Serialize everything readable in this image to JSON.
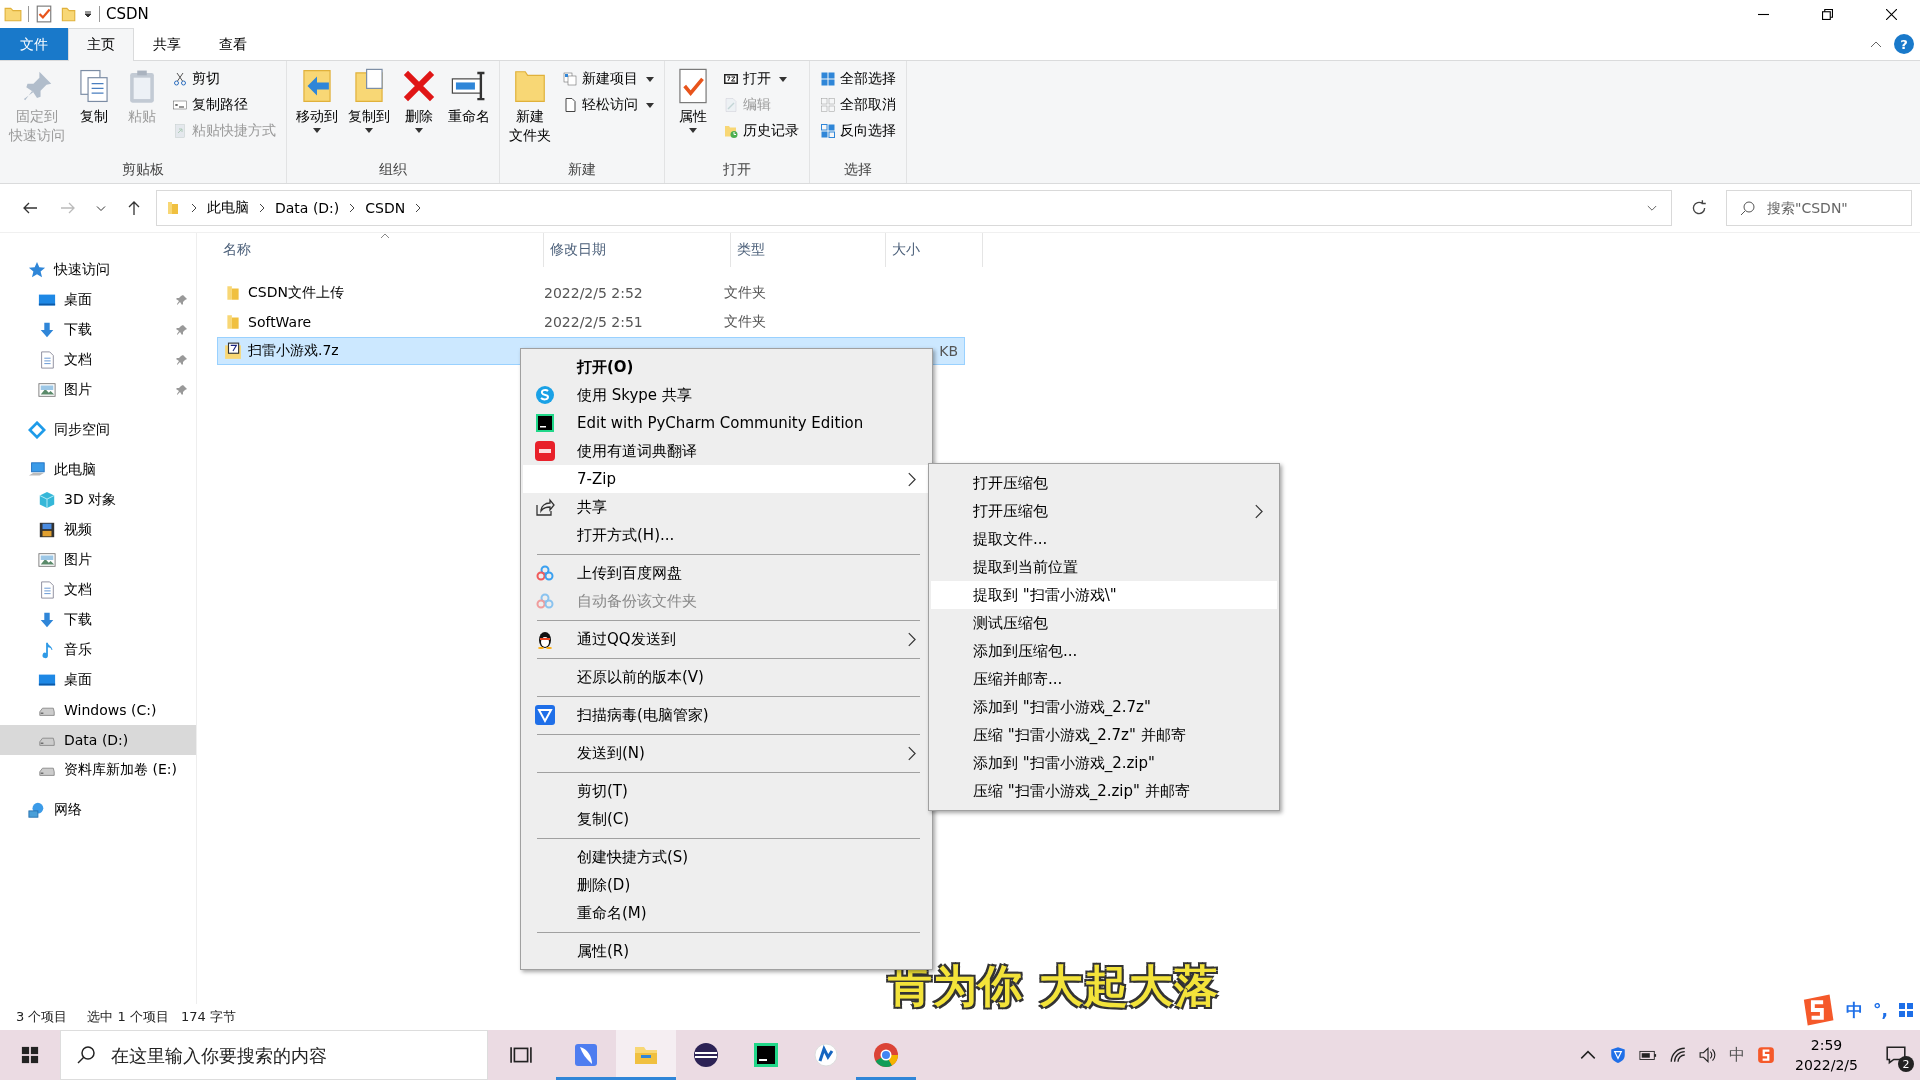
{
  "window": {
    "title": "CSDN"
  },
  "ribbon_tabs": [
    {
      "label": "文件",
      "kind": "file",
      "selected": false
    },
    {
      "label": "主页",
      "kind": "tab",
      "selected": true
    },
    {
      "label": "共享",
      "kind": "tab",
      "selected": false
    },
    {
      "label": "查看",
      "kind": "tab",
      "selected": false
    }
  ],
  "help_label": "?",
  "ribbon_groups": [
    {
      "label": "剪贴板",
      "commands": [
        {
          "label": [
            "固定到",
            "快速访问"
          ],
          "kind": "large",
          "disabled": true,
          "dropdown": false
        },
        {
          "label": [
            "复制"
          ],
          "kind": "large",
          "disabled": false,
          "dropdown": false
        },
        {
          "label": [
            "粘贴"
          ],
          "kind": "large",
          "disabled": true,
          "dropdown": false
        },
        {
          "label": "剪切",
          "kind": "small",
          "disabled": false,
          "dropdown": false
        },
        {
          "label": "复制路径",
          "kind": "small",
          "disabled": false,
          "dropdown": false
        },
        {
          "label": "粘贴快捷方式",
          "kind": "small",
          "disabled": true,
          "dropdown": false
        }
      ]
    },
    {
      "label": "组织",
      "commands": [
        {
          "label": [
            "移动到"
          ],
          "kind": "large",
          "disabled": false,
          "dropdown": true
        },
        {
          "label": [
            "复制到"
          ],
          "kind": "large",
          "disabled": false,
          "dropdown": true
        },
        {
          "label": [
            "删除"
          ],
          "kind": "large",
          "disabled": false,
          "dropdown": true
        },
        {
          "label": [
            "重命名"
          ],
          "kind": "large",
          "disabled": false,
          "dropdown": false
        }
      ]
    },
    {
      "label": "新建",
      "commands": [
        {
          "label": [
            "新建",
            "文件夹"
          ],
          "kind": "large",
          "disabled": false,
          "dropdown": false
        },
        {
          "label": "新建项目",
          "kind": "small",
          "disabled": false,
          "dropdown": true
        },
        {
          "label": "轻松访问",
          "kind": "small",
          "disabled": false,
          "dropdown": true
        }
      ]
    },
    {
      "label": "打开",
      "commands": [
        {
          "label": [
            "属性"
          ],
          "kind": "large",
          "disabled": false,
          "dropdown": true
        },
        {
          "label": "打开",
          "kind": "small",
          "disabled": false,
          "dropdown": true
        },
        {
          "label": "编辑",
          "kind": "small",
          "disabled": true,
          "dropdown": false
        },
        {
          "label": "历史记录",
          "kind": "small",
          "disabled": false,
          "dropdown": false
        }
      ]
    },
    {
      "label": "选择",
      "commands": [
        {
          "label": "全部选择",
          "kind": "small",
          "disabled": false,
          "dropdown": false
        },
        {
          "label": "全部取消",
          "kind": "small",
          "disabled": false,
          "dropdown": false
        },
        {
          "label": "反向选择",
          "kind": "small",
          "disabled": false,
          "dropdown": false
        }
      ]
    }
  ],
  "address": {
    "path": [
      "此电脑",
      "Data (D:)",
      "CSDN"
    ]
  },
  "search": {
    "placeholder": "搜索\"CSDN\""
  },
  "sidebar": {
    "items": [
      {
        "label": "快速访问",
        "kind": "star",
        "selected": false,
        "pinned": false,
        "children": [
          {
            "label": "桌面",
            "kind": "desktop",
            "selected": false,
            "pinned": true
          },
          {
            "label": "下载",
            "kind": "download",
            "selected": false,
            "pinned": true
          },
          {
            "label": "文档",
            "kind": "document",
            "selected": false,
            "pinned": true
          },
          {
            "label": "图片",
            "kind": "picture",
            "selected": false,
            "pinned": true
          }
        ]
      },
      {
        "label": "同步空间",
        "kind": "sync",
        "selected": false,
        "pinned": false
      },
      {
        "label": "此电脑",
        "kind": "pc",
        "selected": false,
        "pinned": false,
        "children": [
          {
            "label": "3D 对象",
            "kind": "cube",
            "selected": false,
            "pinned": false
          },
          {
            "label": "视频",
            "kind": "video",
            "selected": false,
            "pinned": false
          },
          {
            "label": "图片",
            "kind": "picture",
            "selected": false,
            "pinned": false
          },
          {
            "label": "文档",
            "kind": "document",
            "selected": false,
            "pinned": false
          },
          {
            "label": "下载",
            "kind": "download",
            "selected": false,
            "pinned": false
          },
          {
            "label": "音乐",
            "kind": "music",
            "selected": false,
            "pinned": false
          },
          {
            "label": "桌面",
            "kind": "desktop",
            "selected": false,
            "pinned": false
          },
          {
            "label": "Windows (C:)",
            "kind": "drive",
            "selected": false,
            "pinned": false
          },
          {
            "label": "Data (D:)",
            "kind": "drive",
            "selected": true,
            "pinned": false
          },
          {
            "label": "资料库新加卷 (E:)",
            "kind": "drive",
            "selected": false,
            "pinned": false
          }
        ]
      },
      {
        "label": "网络",
        "kind": "network",
        "selected": false,
        "pinned": false
      }
    ]
  },
  "table": {
    "columns": [
      {
        "label": "名称",
        "sorted": true
      },
      {
        "label": "修改日期",
        "sorted": false
      },
      {
        "label": "类型",
        "sorted": false
      },
      {
        "label": "大小",
        "sorted": false
      }
    ],
    "rows": [
      {
        "name": "CSDN文件上传",
        "date": "2022/2/5 2:52",
        "type": "文件夹",
        "size": "",
        "kind": "folder",
        "selected": false
      },
      {
        "name": "SoftWare",
        "date": "2022/2/5 2:51",
        "type": "文件夹",
        "size": "",
        "kind": "folder",
        "selected": false
      },
      {
        "name": "扫雷小游戏.7z",
        "size": "KB",
        "kind": "archive",
        "selected": true
      }
    ]
  },
  "context_menu": {
    "items": [
      {
        "label": "打开(O)",
        "kind": "text",
        "bold": true,
        "disabled": false,
        "submenu": false,
        "selected": false
      },
      {
        "label": "使用 Skype 共享",
        "kind": "skype",
        "bold": false,
        "disabled": false,
        "submenu": false,
        "selected": false
      },
      {
        "label": "Edit with PyCharm Community Edition",
        "kind": "pycharm",
        "bold": false,
        "disabled": false,
        "submenu": false,
        "selected": false
      },
      {
        "label": "使用有道词典翻译",
        "kind": "youdao",
        "bold": false,
        "disabled": false,
        "submenu": false,
        "selected": false
      },
      {
        "label": "7-Zip",
        "kind": "text",
        "bold": false,
        "disabled": false,
        "submenu": true,
        "selected": true
      },
      {
        "label": "共享",
        "kind": "share",
        "bold": false,
        "disabled": false,
        "submenu": false,
        "selected": false
      },
      {
        "label": "打开方式(H)...",
        "kind": "text",
        "bold": false,
        "disabled": false,
        "submenu": false,
        "selected": false
      },
      {
        "kind": "separator"
      },
      {
        "label": "上传到百度网盘",
        "kind": "cloud",
        "bold": false,
        "disabled": false,
        "submenu": false,
        "selected": false
      },
      {
        "label": "自动备份该文件夹",
        "kind": "cloud",
        "bold": false,
        "disabled": true,
        "submenu": false,
        "selected": false
      },
      {
        "kind": "separator"
      },
      {
        "label": "通过QQ发送到",
        "kind": "penguin",
        "bold": false,
        "disabled": false,
        "submenu": true,
        "selected": false
      },
      {
        "kind": "separator"
      },
      {
        "label": "还原以前的版本(V)",
        "kind": "text",
        "bold": false,
        "disabled": false,
        "submenu": false,
        "selected": false
      },
      {
        "kind": "separator"
      },
      {
        "label": "扫描病毒(电脑管家)",
        "kind": "shield",
        "bold": false,
        "disabled": false,
        "submenu": false,
        "selected": false
      },
      {
        "kind": "separator"
      },
      {
        "label": "发送到(N)",
        "kind": "text",
        "bold": false,
        "disabled": false,
        "submenu": true,
        "selected": false
      },
      {
        "kind": "separator"
      },
      {
        "label": "剪切(T)",
        "kind": "text",
        "bold": false,
        "disabled": false,
        "submenu": false,
        "selected": false
      },
      {
        "label": "复制(C)",
        "kind": "text",
        "bold": false,
        "disabled": false,
        "submenu": false,
        "selected": false
      },
      {
        "kind": "separator"
      },
      {
        "label": "创建快捷方式(S)",
        "kind": "text",
        "bold": false,
        "disabled": false,
        "submenu": false,
        "selected": false
      },
      {
        "label": "删除(D)",
        "kind": "text",
        "bold": false,
        "disabled": false,
        "submenu": false,
        "selected": false
      },
      {
        "label": "重命名(M)",
        "kind": "text",
        "bold": false,
        "disabled": false,
        "submenu": false,
        "selected": false
      },
      {
        "kind": "separator"
      },
      {
        "label": "属性(R)",
        "kind": "text",
        "bold": false,
        "disabled": false,
        "submenu": false,
        "selected": false
      }
    ]
  },
  "submenu": {
    "items": [
      {
        "label": "打开压缩包",
        "submenu": false,
        "selected": false
      },
      {
        "label": "打开压缩包",
        "submenu": true,
        "selected": false
      },
      {
        "label": "提取文件...",
        "submenu": false,
        "selected": false
      },
      {
        "label": "提取到当前位置",
        "submenu": false,
        "selected": false
      },
      {
        "label": "提取到 \"扫雷小游戏\\\"",
        "submenu": false,
        "selected": true
      },
      {
        "label": "测试压缩包",
        "submenu": false,
        "selected": false
      },
      {
        "label": "添加到压缩包...",
        "submenu": false,
        "selected": false
      },
      {
        "label": "压缩并邮寄...",
        "submenu": false,
        "selected": false
      },
      {
        "label": "添加到 \"扫雷小游戏_2.7z\"",
        "submenu": false,
        "selected": false
      },
      {
        "label": "压缩 \"扫雷小游戏_2.7z\" 并邮寄",
        "submenu": false,
        "selected": false
      },
      {
        "label": "添加到 \"扫雷小游戏_2.zip\"",
        "submenu": false,
        "selected": false
      },
      {
        "label": "压缩 \"扫雷小游戏_2.zip\" 并邮寄",
        "submenu": false,
        "selected": false
      }
    ]
  },
  "status_bar": {
    "item_count": "3 个项目",
    "selection": "选中 1 个项目",
    "size": "174 字节"
  },
  "lyrics": "肯为你 大起大落",
  "ime_bar": {
    "mode": "中",
    "punctuation": "°,"
  },
  "taskbar": {
    "search_placeholder": "在这里输入你要搜索的内容",
    "apps": [
      {
        "kind": "feather",
        "active": false,
        "running": true
      },
      {
        "kind": "explorer",
        "active": true,
        "running": true
      },
      {
        "kind": "eclipse",
        "active": false,
        "running": false
      },
      {
        "kind": "pycharm",
        "active": false,
        "running": false
      },
      {
        "kind": "app",
        "active": false,
        "running": false
      },
      {
        "kind": "chrome",
        "active": false,
        "running": true
      }
    ],
    "input_indicator": "中",
    "time": "2:59",
    "date": "2022/2/5",
    "notifications": "2"
  }
}
